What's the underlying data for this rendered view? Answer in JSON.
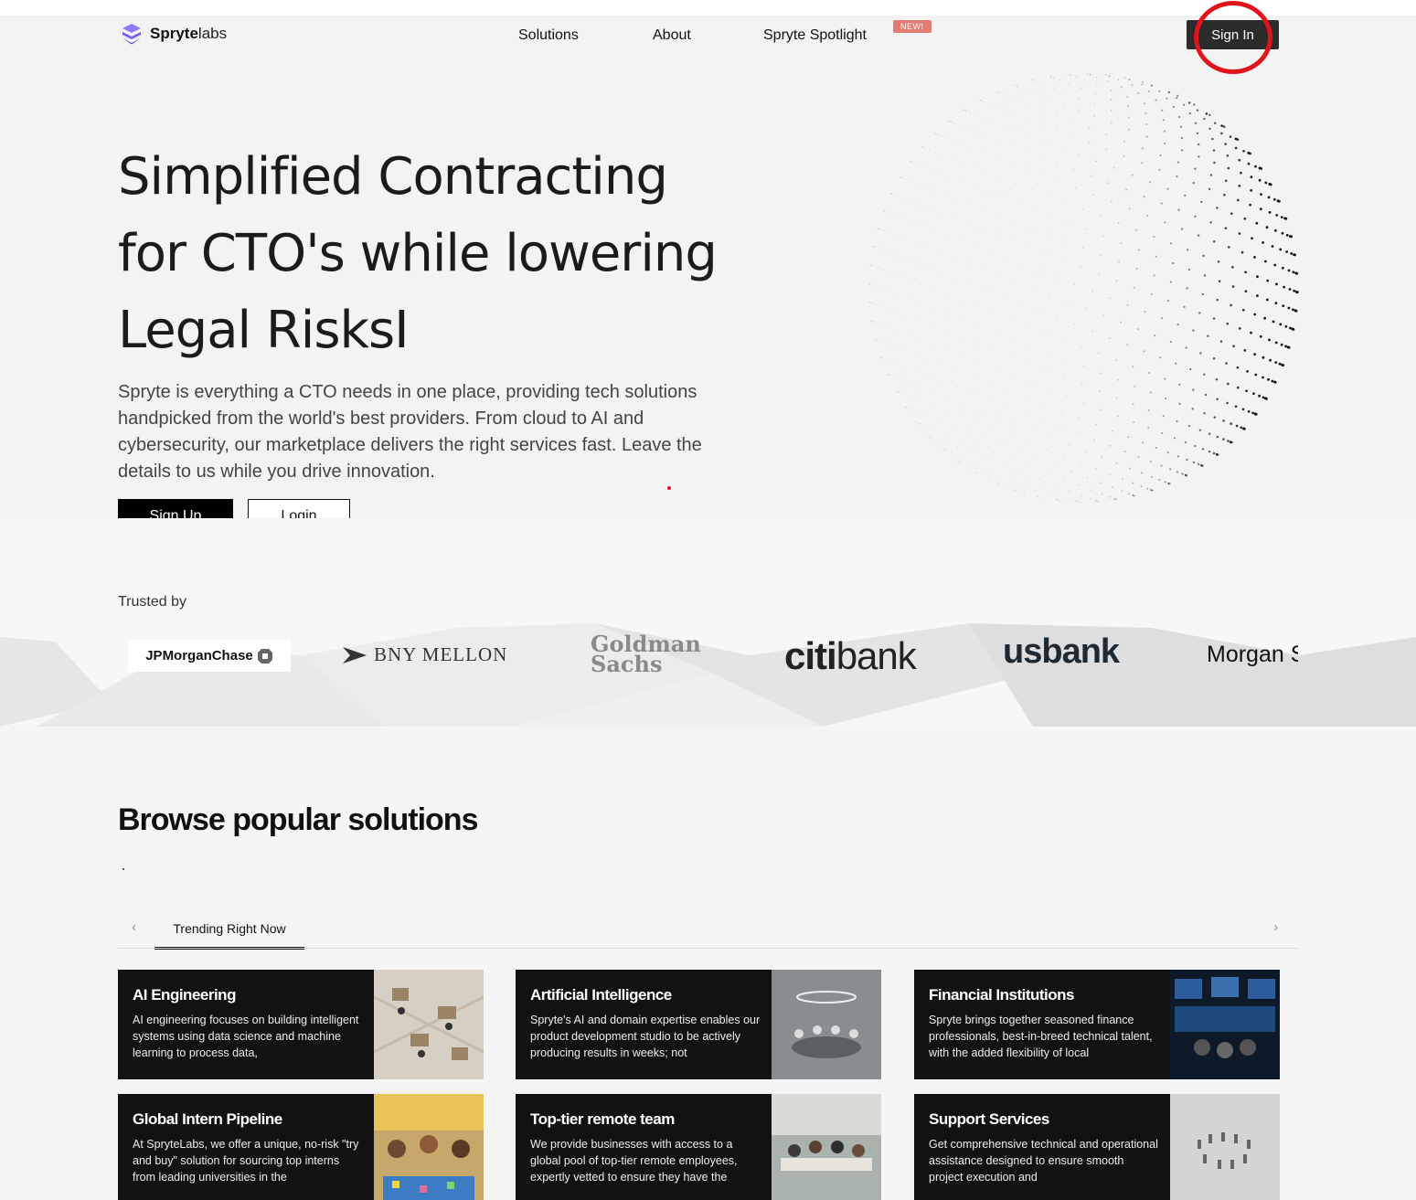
{
  "brand": {
    "name_bold": "Spryte",
    "name_rest": "labs"
  },
  "nav": {
    "solutions": "Solutions",
    "about": "About",
    "spotlight": "Spryte Spotlight",
    "new_badge": "NEW!",
    "sign_in": "Sign In"
  },
  "hero": {
    "title_line1": "Simplified Contracting",
    "title_line2": "for CTO's while lowering",
    "title_line3": "Legal RisksI",
    "description": "Spryte is everything a CTO needs in one place, providing tech solutions handpicked from the world's best providers. From cloud to AI and cybersecurity, our marketplace delivers the right services fast. Leave the details to us while you drive innovation.",
    "signup_label": "Sign Up",
    "login_label": "Login"
  },
  "trusted": {
    "label": "Trusted by",
    "logos": {
      "jpm": "JPMorganChase",
      "bny": "BNY MELLON",
      "gs_line1": "Goldman",
      "gs_line2": "Sachs",
      "citi_part1": "citi",
      "citi_part2": "bank",
      "usbank_part1": "us",
      "usbank_part2": "bank",
      "morgan": "Morgan S"
    }
  },
  "browse": {
    "heading": "Browse popular solutions",
    "tab_active": "Trending Right Now",
    "prev_icon": "chevron-left-icon",
    "next_icon": "chevron-right-icon",
    "cards": [
      {
        "title": "AI Engineering",
        "desc": "AI engineering focuses on building intelligent systems using data science and machine learning to process data,"
      },
      {
        "title": "Artificial Intelligence",
        "desc": "Spryte's AI and domain expertise enables our product development studio to be actively producing results in weeks; not"
      },
      {
        "title": "Financial Institutions",
        "desc": "Spryte brings together seasoned finance professionals, best-in-breed technical talent, with the added flexibility of local"
      },
      {
        "title": "Global Intern Pipeline",
        "desc": "At SpryteLabs, we offer a unique, no-risk \"try and buy\" solution for sourcing top interns from leading universities in the"
      },
      {
        "title": "Top-tier remote team",
        "desc": "We provide businesses with access to a global pool of top-tier remote employees, expertly vetted to ensure they have the"
      },
      {
        "title": "Support Services",
        "desc": "Get comprehensive technical and operational assistance designed to ensure smooth project execution and"
      }
    ]
  },
  "colors": {
    "brand_purple": "#6d5cf2",
    "highlight_red": "#e0151b",
    "new_badge": "#e27b72",
    "card_bg": "#121212"
  }
}
